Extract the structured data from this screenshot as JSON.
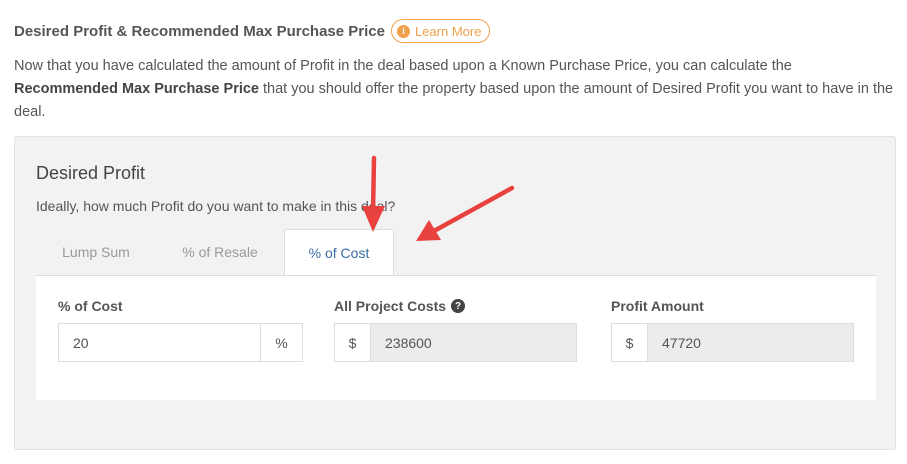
{
  "header": {
    "title": "Desired Profit & Recommended Max Purchase Price",
    "learn_more": "Learn More",
    "info_glyph": "i"
  },
  "description": {
    "part1": "Now that you have calculated the amount of Profit in the deal based upon a Known Purchase Price, you can calculate the ",
    "bold": "Recommended Max Purchase Price",
    "part2": " that you should offer the property based upon the amount of Desired Profit you want to have in the deal."
  },
  "panel": {
    "title": "Desired Profit",
    "question": "Ideally, how much Profit do you want to make in this deal?",
    "tabs": [
      {
        "label": "Lump Sum",
        "active": false
      },
      {
        "label": "% of Resale",
        "active": false
      },
      {
        "label": "% of Cost",
        "active": true
      }
    ],
    "fields": {
      "percent_of_cost": {
        "label": "% of Cost",
        "value": "20",
        "suffix": "%"
      },
      "all_project_costs": {
        "label": "All Project Costs",
        "prefix": "$",
        "value": "238600",
        "help_glyph": "?"
      },
      "profit_amount": {
        "label": "Profit Amount",
        "prefix": "$",
        "value": "47720"
      }
    }
  },
  "colors": {
    "accent_orange": "#f0a04b",
    "active_tab_text": "#3a6ea5",
    "arrow_red": "#e8413e"
  }
}
